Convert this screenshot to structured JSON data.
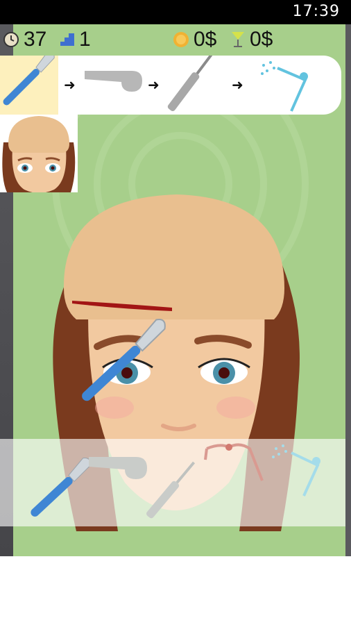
{
  "status_bar": {
    "time": "17:39"
  },
  "hud": {
    "timer": {
      "icon": "clock-icon",
      "value": "37"
    },
    "level": {
      "icon": "stairs-icon",
      "value": "1"
    },
    "coins": {
      "icon": "coin-icon",
      "value": "0$"
    },
    "tips": {
      "icon": "cocktail-glass-icon",
      "value": "0$"
    }
  },
  "procedure_steps": [
    {
      "tool": "scalpel",
      "icon": "scalpel-icon",
      "active": true
    },
    {
      "tool": "retractor",
      "icon": "retractor-icon",
      "active": false
    },
    {
      "tool": "needle",
      "icon": "needle-icon",
      "active": false
    },
    {
      "tool": "water-spray",
      "icon": "water-spray-icon",
      "active": false
    }
  ],
  "toolbar": [
    {
      "tool": "scalpel",
      "icon": "scalpel-icon"
    },
    {
      "tool": "retractor",
      "icon": "retractor-icon"
    },
    {
      "tool": "needle",
      "icon": "needle-icon"
    },
    {
      "tool": "suture",
      "icon": "suture-icon"
    },
    {
      "tool": "water-spray",
      "icon": "water-spray-icon"
    }
  ],
  "colors": {
    "background_green": "#a7cf8b",
    "skin": "#f2c9a0",
    "scalp": "#e9bf8f",
    "hair": "#7a3a1e",
    "scalpel_handle": "#3f86d4",
    "active_step_highlight": "#fdf0bd"
  }
}
